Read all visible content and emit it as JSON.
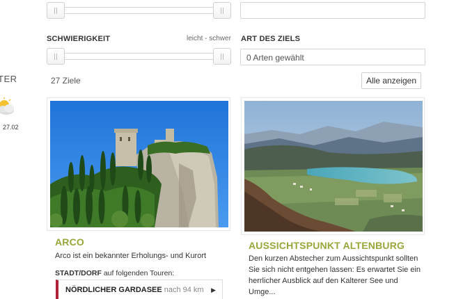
{
  "weather": {
    "label": "TER",
    "icon": "partly-cloudy-icon",
    "date": "27.02"
  },
  "filters": {
    "top_slider": {
      "min": 0,
      "max": 1
    },
    "difficulty": {
      "label": "SCHWIERIGKEIT",
      "hint": "leicht - schwer",
      "min": 0,
      "max": 1
    },
    "destination_type": {
      "label": "ART DES ZIELS",
      "value": "0 Arten gewählt"
    },
    "top_text_box": {
      "value": ""
    }
  },
  "results": {
    "count_text": "27 Ziele",
    "show_all_label": "Alle anzeigen"
  },
  "cards": [
    {
      "title": "ARCO",
      "description": "Arco ist ein bekannter Erholungs- und Kurort",
      "tours_prefix": "STADT/DORF",
      "tours_suffix": "auf folgenden Touren:",
      "tour": {
        "name": "NÖRDLICHER GARDASEE",
        "distance": "nach 94 km",
        "arrow": "▶"
      }
    },
    {
      "title": "AUSSICHTSPUNKT ALTENBURG",
      "description_lines": [
        "Den kurzen Abstecher zum Aussichtspunkt sollten",
        "Sie sich nicht entgehen lassen: Es erwartet Sie ein",
        "herrlicher Ausblick auf den Kalterer See und",
        "Umge..."
      ]
    }
  ],
  "colors": {
    "title_green": "#9aa53a",
    "tour_accent": "#b0223a"
  }
}
